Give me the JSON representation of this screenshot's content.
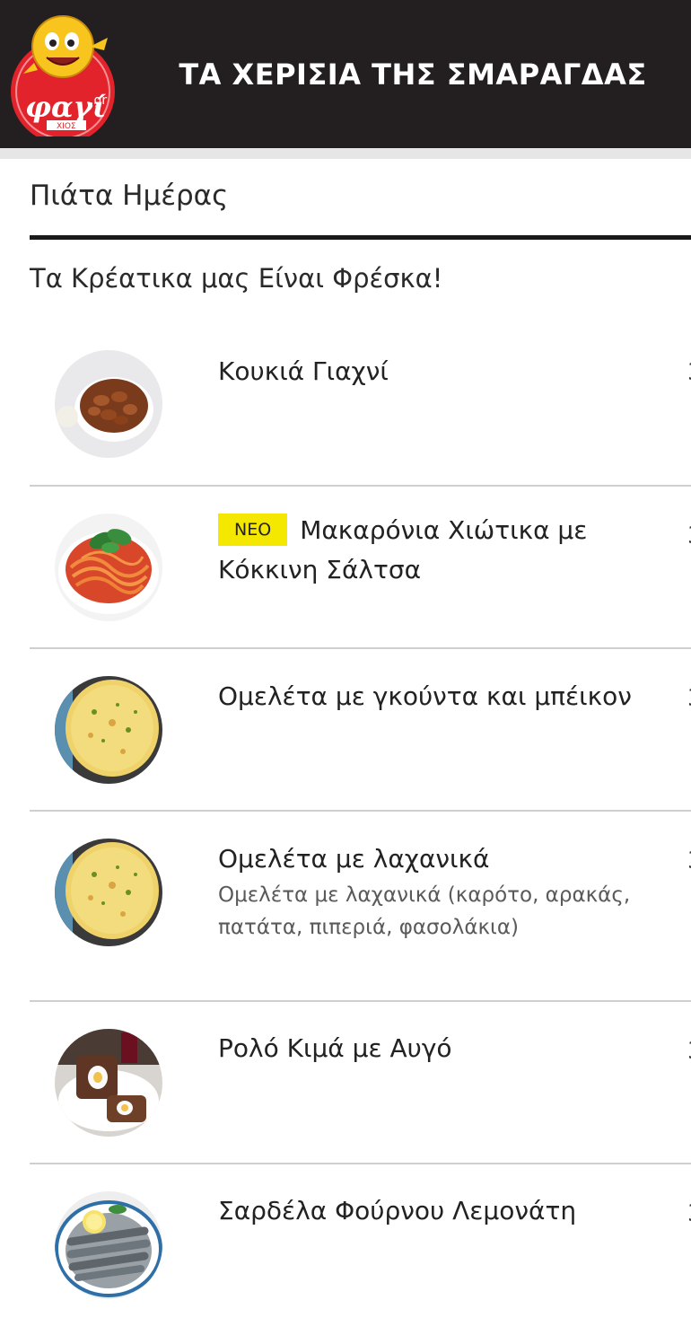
{
  "header": {
    "title": "ΤΑ ΧΕΡΙΣΙΑ ΤΗΣ ΣΜΑΡΑΓΔΑΣ",
    "logo_text": "φαγί",
    "logo_suffix": ".gr",
    "logo_subtext": "ΧΙΟΣ"
  },
  "section": {
    "title": "Πιάτα Ημέρας"
  },
  "category": {
    "title": "Τα Κρέατικα μας Είναι Φρέσκα!"
  },
  "colors": {
    "header_bg": "#231f20",
    "badge_bg": "#f5e800",
    "logo_red": "#e3232b"
  },
  "items": [
    {
      "name": "Κουκιά Γιαχνί",
      "badge": "",
      "description": "",
      "image": "beans-stew-image"
    },
    {
      "name": "Μακαρόνια Χιώτικα με Κόκκινη Σάλτσα",
      "badge": "ΝΕΟ",
      "description": "",
      "image": "spaghetti-image"
    },
    {
      "name": "Ομελέτα με γκούντα και μπέικον",
      "badge": "",
      "description": "",
      "image": "omelette-image"
    },
    {
      "name": "Ομελέτα με λαχανικά",
      "badge": "",
      "description": "Ομελέτα με λαχανικά (καρότο, αρακάς, πατάτα, πιπεριά, φασολάκια)",
      "image": "omelette-image"
    },
    {
      "name": "Ρολό Κιμά με Αυγό",
      "badge": "",
      "description": "",
      "image": "meatloaf-image"
    },
    {
      "name": "Σαρδέλα Φούρνου Λεμονάτη",
      "badge": "",
      "description": "",
      "image": "sardines-image"
    }
  ]
}
